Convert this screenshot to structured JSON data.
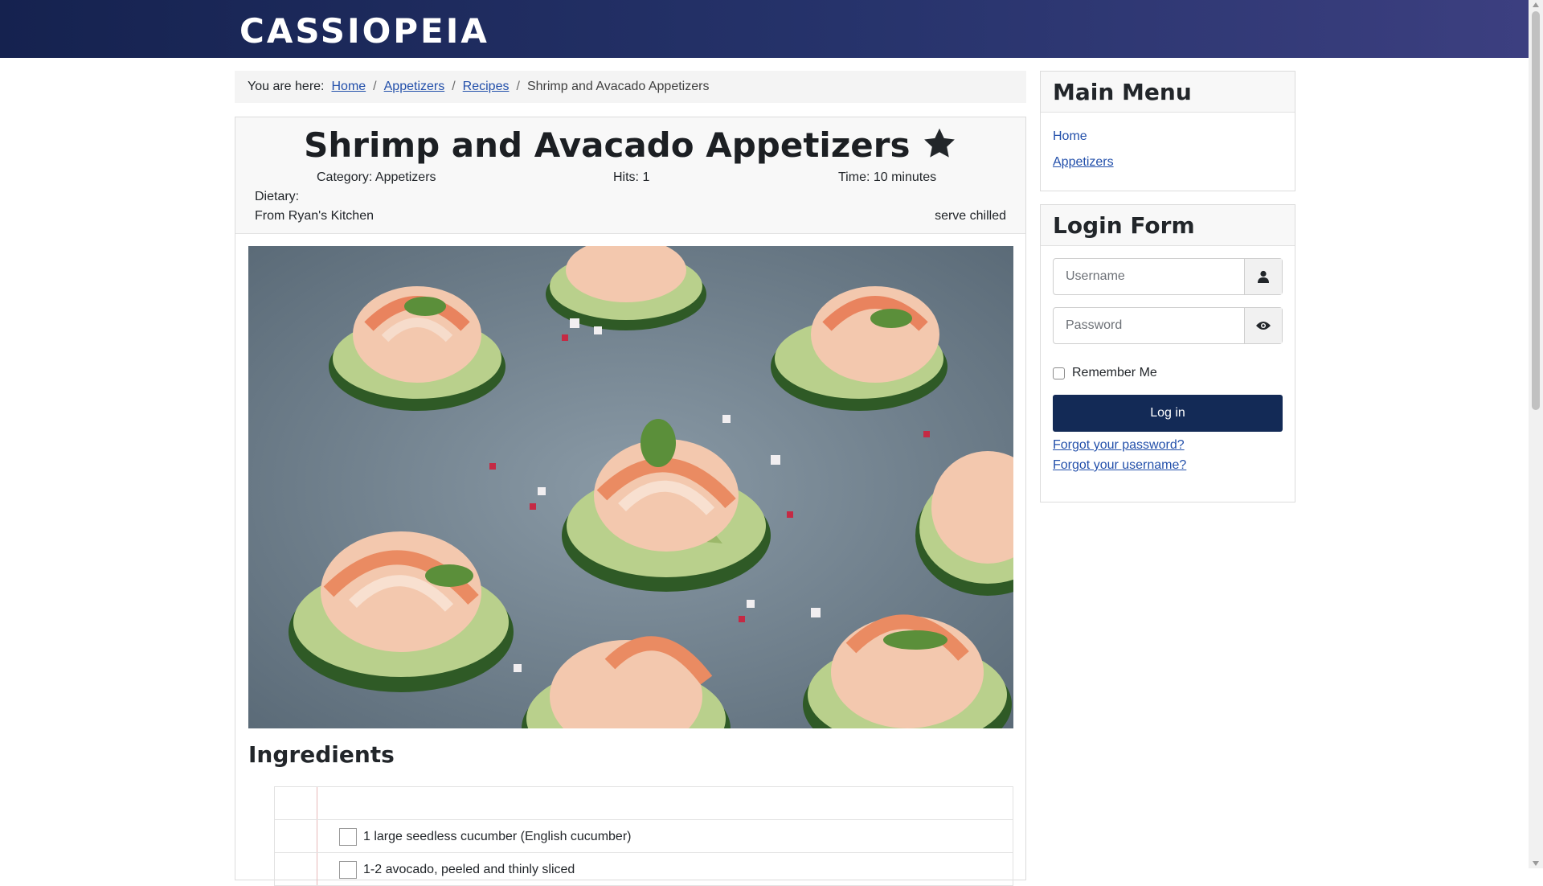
{
  "site": {
    "brand": "CASSIOPEIA"
  },
  "breadcrumb": {
    "prefix": "You are here:",
    "items": [
      "Home",
      "Appetizers",
      "Recipes"
    ],
    "current": "Shrimp and Avacado Appetizers"
  },
  "article": {
    "title": "Shrimp and Avacado Appetizers",
    "category": "Category: Appetizers",
    "hits": "Hits: 1",
    "time": "Time: 10 minutes",
    "dietary": "Dietary:",
    "source": "From Ryan's Kitchen",
    "serving_note": "serve chilled",
    "ingredients_heading": "Ingredients",
    "ingredients": [
      "1 large seedless cucumber (English cucumber)",
      "1-2 avocado, peeled and thinly sliced"
    ]
  },
  "main_menu": {
    "heading": "Main Menu",
    "items": [
      "Home",
      "Appetizers"
    ]
  },
  "login": {
    "heading": "Login Form",
    "username_placeholder": "Username",
    "password_placeholder": "Password",
    "remember_label": "Remember Me",
    "login_label": "Log in",
    "forgot_password": "Forgot your password?",
    "forgot_username": "Forgot your username?"
  },
  "colors": {
    "header": "#15224f",
    "accent": "#132a56",
    "link": "#224faa"
  }
}
